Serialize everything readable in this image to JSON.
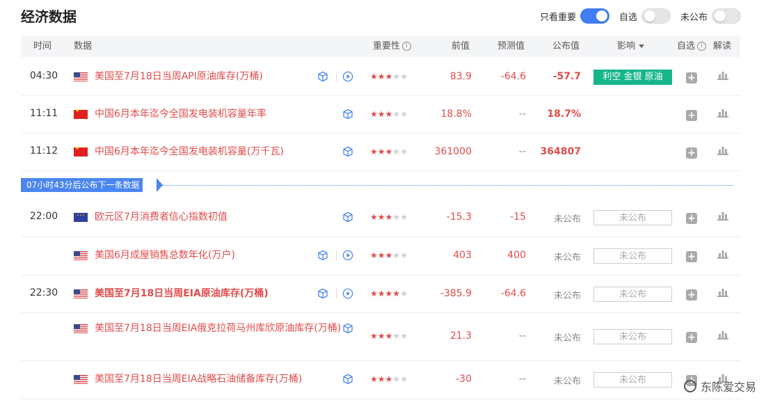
{
  "page_title": "经济数据",
  "toggles": [
    {
      "label": "只看重要",
      "on": true
    },
    {
      "label": "自选",
      "on": false
    },
    {
      "label": "未公布",
      "on": false
    }
  ],
  "header": {
    "time": "时间",
    "data": "数据",
    "importance": "重要性",
    "previous": "前值",
    "forecast": "预测值",
    "actual": "公布值",
    "impact": "影响",
    "watchlist": "自选",
    "interpret": "解读",
    "info_glyph": "i"
  },
  "next_release_banner": "07小时43分后公布下一条数据",
  "rows": [
    {
      "time": "04:30",
      "flag": "us",
      "name": "美国至7月18日当周API原油库存(万桶)",
      "bold": false,
      "has_play": true,
      "stars": 3,
      "previous": "83.9",
      "forecast": "-64.6",
      "actual": "-57.7",
      "impact": "利空 金银 原油",
      "impact_type": "green"
    },
    {
      "time": "11:11",
      "flag": "cn",
      "name": "中国6月本年迄今全国发电装机容量年率",
      "bold": false,
      "has_play": false,
      "stars": 3,
      "previous": "18.8%",
      "forecast": "--",
      "actual": "18.7%",
      "impact": "",
      "impact_type": "none"
    },
    {
      "time": "11:12",
      "flag": "cn",
      "name": "中国6月本年迄今全国发电装机容量(万千瓦)",
      "bold": false,
      "has_play": false,
      "stars": 3,
      "previous": "361000",
      "forecast": "--",
      "actual": "364807",
      "impact": "",
      "impact_type": "none"
    },
    {
      "time": "22:00",
      "flag": "eu",
      "name": "欧元区7月消费者信心指数初值",
      "bold": false,
      "has_play": false,
      "stars": 3,
      "previous": "-15.3",
      "forecast": "-15",
      "actual": "未公布",
      "impact": "未公布",
      "impact_type": "box"
    },
    {
      "time": "",
      "flag": "us",
      "name": "美国6月成屋销售总数年化(万户)",
      "bold": false,
      "has_play": true,
      "stars": 3,
      "previous": "403",
      "forecast": "400",
      "actual": "未公布",
      "impact": "未公布",
      "impact_type": "box"
    },
    {
      "time": "22:30",
      "flag": "us",
      "name": "美国至7月18日当周EIA原油库存(万桶)",
      "bold": true,
      "has_play": true,
      "stars": 4,
      "previous": "-385.9",
      "forecast": "-64.6",
      "actual": "未公布",
      "impact": "未公布",
      "impact_type": "box"
    },
    {
      "time": "",
      "flag": "us",
      "name": "美国至7月18日当周EIA俄克拉荷马州库欣原油库存(万桶)",
      "bold": false,
      "has_play": false,
      "stars": 3,
      "previous": "21.3",
      "forecast": "--",
      "actual": "未公布",
      "impact": "未公布",
      "impact_type": "box"
    },
    {
      "time": "",
      "flag": "us",
      "name": "美国至7月18日当周EIA战略石油储备库存(万桶)",
      "bold": false,
      "has_play": false,
      "stars": 3,
      "previous": "-30",
      "forecast": "--",
      "actual": "未公布",
      "impact": "未公布",
      "impact_type": "box"
    }
  ],
  "icons": {
    "plus_glyph": "+",
    "star_glyph": "★"
  },
  "watermark": "东陈爱交易",
  "colors": {
    "red": "#e14b4b",
    "blue": "#3f7ef6",
    "green": "#16b58a",
    "gray": "#888888"
  }
}
